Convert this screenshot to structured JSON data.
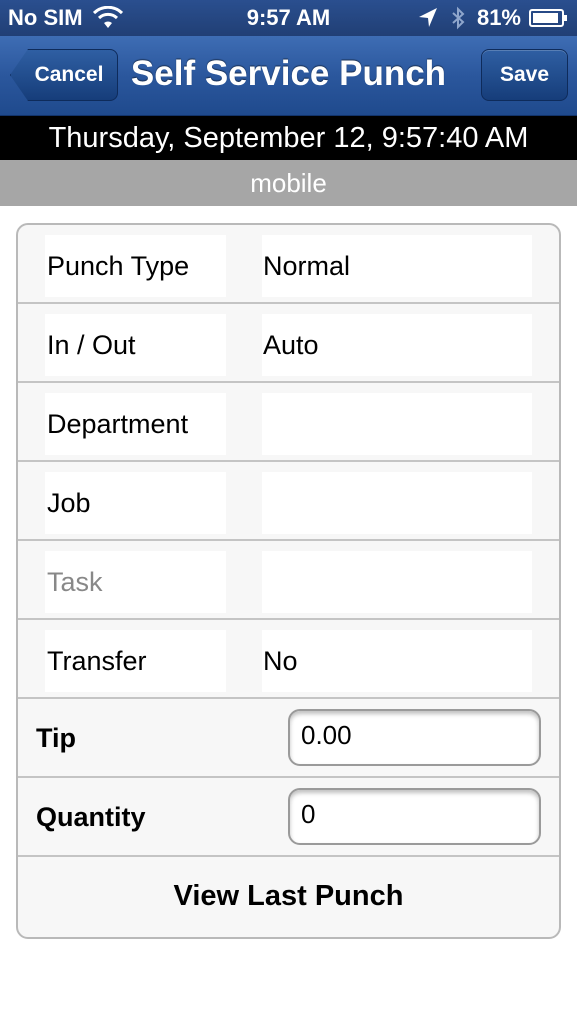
{
  "status_bar": {
    "carrier": "No SIM",
    "time": "9:57 AM",
    "battery": "81%",
    "icons": [
      "wifi-icon",
      "location-arrow-icon",
      "bluetooth-icon",
      "battery-icon"
    ]
  },
  "nav": {
    "title": "Self Service Punch",
    "cancel_label": "Cancel",
    "save_label": "Save"
  },
  "date_banner": "Thursday, September 12, 9:57:40 AM",
  "sub_banner": "mobile",
  "form": {
    "rows": [
      {
        "label": "Punch Type",
        "value": "Normal"
      },
      {
        "label": "In / Out",
        "value": "Auto"
      },
      {
        "label": "Department",
        "value": ""
      },
      {
        "label": "Job",
        "value": ""
      },
      {
        "label": "Task",
        "value": ""
      },
      {
        "label": "Transfer",
        "value": "No"
      }
    ],
    "tip_label": "Tip",
    "tip_value": "0.00",
    "quantity_label": "Quantity",
    "quantity_value": "0",
    "view_last_label": "View Last Punch"
  },
  "colors": {
    "nav_blue": "#2b579d",
    "banner_black": "#000000",
    "sub_banner_gray": "#a6a6a6",
    "muted_text": "#888888"
  }
}
